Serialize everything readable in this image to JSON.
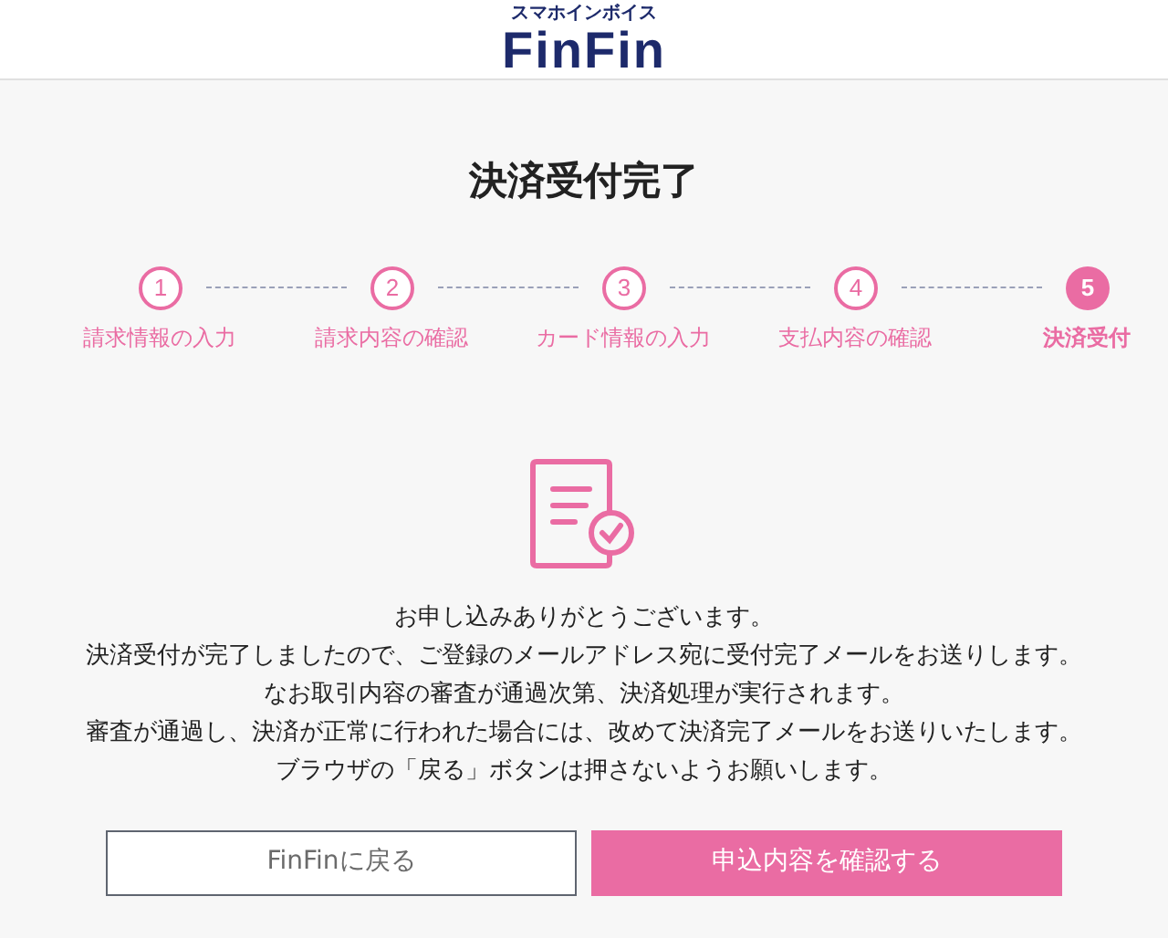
{
  "header": {
    "tagline": "スマホインボイス",
    "logo": "FinFin"
  },
  "title": "決済受付完了",
  "steps": [
    {
      "number": "1",
      "label": "請求情報の入力",
      "selected": false
    },
    {
      "number": "2",
      "label": "請求内容の確認",
      "selected": false
    },
    {
      "number": "3",
      "label": "カード情報の入力",
      "selected": false
    },
    {
      "number": "4",
      "label": "支払内容の確認",
      "selected": false
    },
    {
      "number": "5",
      "label": "決済受付",
      "selected": true
    }
  ],
  "message": [
    "お申し込みありがとうございます。",
    "決済受付が完了しましたので、ご登録のメールアドレス宛に受付完了メールをお送りします。",
    "なお取引内容の審査が通過次第、決済処理が実行されます。",
    "審査が通過し、決済が正常に行われた場合には、改めて決済完了メールをお送りいたします。",
    "ブラウザの「戻る」ボタンは押さないようお願いします。"
  ],
  "buttons": [
    {
      "label": "FinFinに戻る",
      "kind": "secondary"
    },
    {
      "label": "申込内容を確認する",
      "kind": "primary"
    }
  ]
}
